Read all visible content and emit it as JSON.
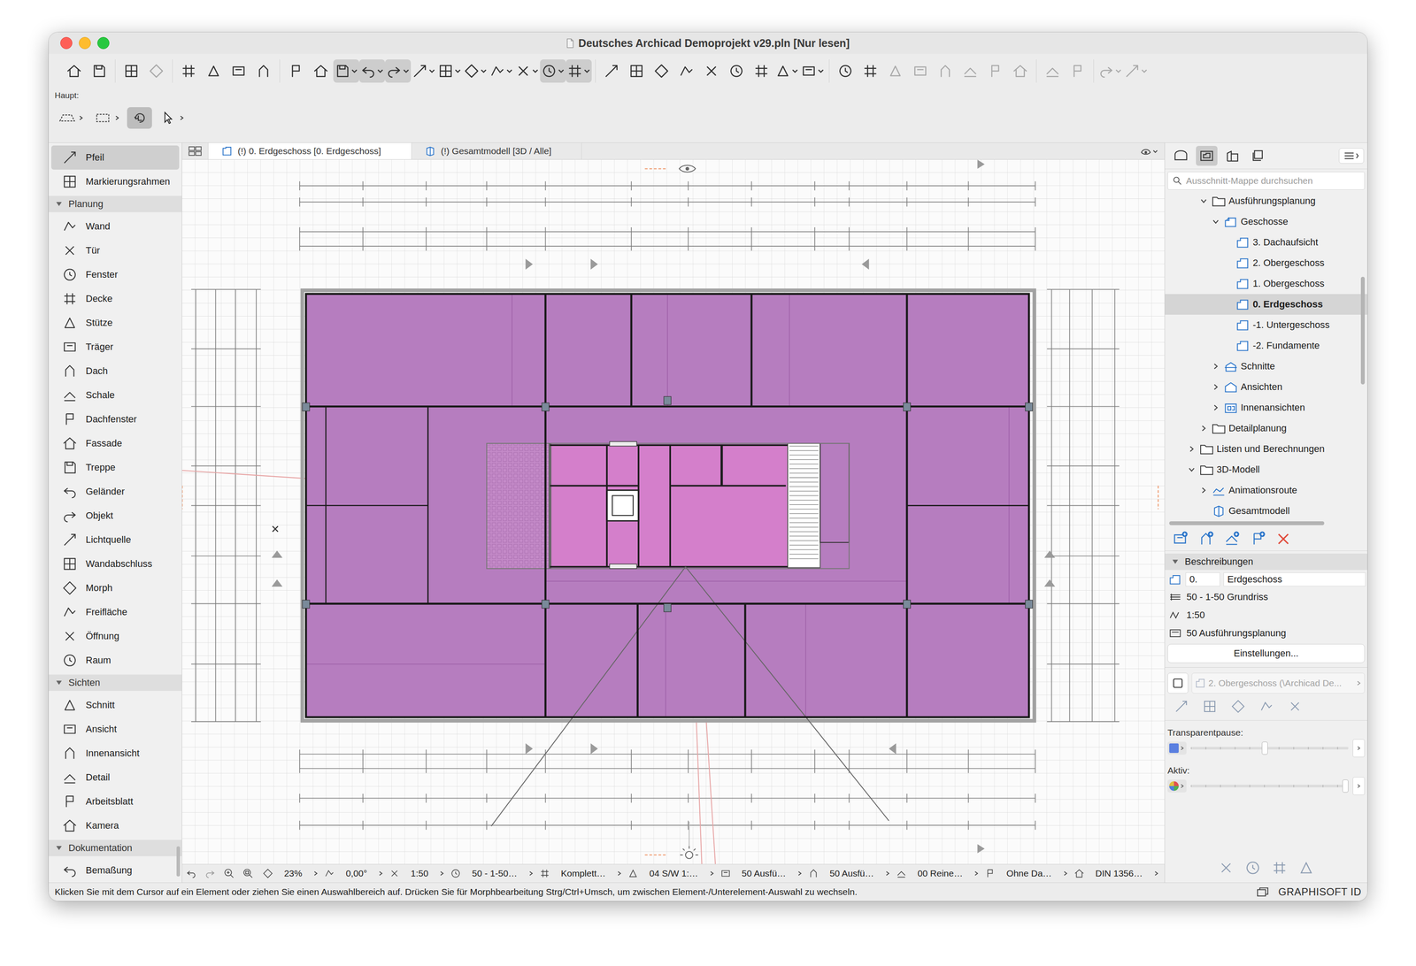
{
  "window": {
    "title": "Deutsches Archicad Demoprojekt v29.pln [Nur lesen]"
  },
  "toolbar": {
    "groups": [
      [
        {
          "pressed": false,
          "dropdown": false,
          "disabled": false
        },
        {
          "pressed": false,
          "dropdown": false,
          "disabled": false
        }
      ],
      [
        {
          "pressed": false,
          "dropdown": false,
          "disabled": false
        },
        {
          "pressed": false,
          "dropdown": false,
          "disabled": true
        }
      ],
      [
        {
          "pressed": false,
          "dropdown": false,
          "disabled": false
        },
        {
          "pressed": false,
          "dropdown": false,
          "disabled": false
        },
        {
          "pressed": false,
          "dropdown": false,
          "disabled": false
        },
        {
          "pressed": false,
          "dropdown": false,
          "disabled": false
        }
      ],
      [
        {
          "pressed": false,
          "dropdown": false,
          "disabled": false
        },
        {
          "pressed": false,
          "dropdown": false,
          "disabled": false
        },
        {
          "pressed": true,
          "dropdown": true,
          "disabled": false
        },
        {
          "pressed": true,
          "dropdown": true,
          "disabled": false
        },
        {
          "pressed": true,
          "dropdown": true,
          "disabled": false
        },
        {
          "pressed": false,
          "dropdown": true,
          "disabled": false
        },
        {
          "pressed": false,
          "dropdown": true,
          "disabled": false
        },
        {
          "pressed": false,
          "dropdown": true,
          "disabled": false
        },
        {
          "pressed": false,
          "dropdown": true,
          "disabled": false
        },
        {
          "pressed": false,
          "dropdown": true,
          "disabled": false
        },
        {
          "pressed": true,
          "dropdown": true,
          "disabled": false
        },
        {
          "pressed": true,
          "dropdown": true,
          "disabled": false
        }
      ],
      [
        {
          "pressed": false,
          "dropdown": false,
          "disabled": false
        },
        {
          "pressed": false,
          "dropdown": false,
          "disabled": false
        },
        {
          "pressed": false,
          "dropdown": false,
          "disabled": false
        },
        {
          "pressed": false,
          "dropdown": false,
          "disabled": false
        },
        {
          "pressed": false,
          "dropdown": false,
          "disabled": false
        },
        {
          "pressed": false,
          "dropdown": false,
          "disabled": false
        },
        {
          "pressed": false,
          "dropdown": false,
          "disabled": false
        },
        {
          "pressed": false,
          "dropdown": true,
          "disabled": false
        },
        {
          "pressed": false,
          "dropdown": true,
          "disabled": false
        }
      ],
      [
        {
          "pressed": false,
          "dropdown": false,
          "disabled": false
        },
        {
          "pressed": false,
          "dropdown": false,
          "disabled": false
        },
        {
          "pressed": false,
          "dropdown": false,
          "disabled": true
        },
        {
          "pressed": false,
          "dropdown": false,
          "disabled": true
        },
        {
          "pressed": false,
          "dropdown": false,
          "disabled": true
        },
        {
          "pressed": false,
          "dropdown": false,
          "disabled": true
        },
        {
          "pressed": false,
          "dropdown": false,
          "disabled": true
        },
        {
          "pressed": false,
          "dropdown": false,
          "disabled": true
        }
      ],
      [
        {
          "pressed": false,
          "dropdown": false,
          "disabled": true
        },
        {
          "pressed": false,
          "dropdown": false,
          "disabled": true
        }
      ],
      [
        {
          "pressed": false,
          "dropdown": true,
          "disabled": true
        },
        {
          "pressed": false,
          "dropdown": true,
          "disabled": true
        }
      ]
    ]
  },
  "infobox": {
    "label": "Haupt:"
  },
  "toolbox": {
    "items": [
      {
        "kind": "tool",
        "label": "Pfeil",
        "selected": true,
        "expanded": false
      },
      {
        "kind": "tool",
        "label": "Markierungsrahmen",
        "selected": false,
        "expanded": false
      },
      {
        "kind": "section",
        "label": "Planung",
        "selected": false,
        "expanded": true
      },
      {
        "kind": "tool",
        "label": "Wand",
        "selected": false,
        "expanded": false
      },
      {
        "kind": "tool",
        "label": "Tür",
        "selected": false,
        "expanded": false
      },
      {
        "kind": "tool",
        "label": "Fenster",
        "selected": false,
        "expanded": false
      },
      {
        "kind": "tool",
        "label": "Decke",
        "selected": false,
        "expanded": false
      },
      {
        "kind": "tool",
        "label": "Stütze",
        "selected": false,
        "expanded": false
      },
      {
        "kind": "tool",
        "label": "Träger",
        "selected": false,
        "expanded": false
      },
      {
        "kind": "tool",
        "label": "Dach",
        "selected": false,
        "expanded": false
      },
      {
        "kind": "tool",
        "label": "Schale",
        "selected": false,
        "expanded": false
      },
      {
        "kind": "tool",
        "label": "Dachfenster",
        "selected": false,
        "expanded": false
      },
      {
        "kind": "tool",
        "label": "Fassade",
        "selected": false,
        "expanded": false
      },
      {
        "kind": "tool",
        "label": "Treppe",
        "selected": false,
        "expanded": false
      },
      {
        "kind": "tool",
        "label": "Geländer",
        "selected": false,
        "expanded": false
      },
      {
        "kind": "tool",
        "label": "Objekt",
        "selected": false,
        "expanded": false
      },
      {
        "kind": "tool",
        "label": "Lichtquelle",
        "selected": false,
        "expanded": false
      },
      {
        "kind": "tool",
        "label": "Wandabschluss",
        "selected": false,
        "expanded": false
      },
      {
        "kind": "tool",
        "label": "Morph",
        "selected": false,
        "expanded": false
      },
      {
        "kind": "tool",
        "label": "Freifläche",
        "selected": false,
        "expanded": false
      },
      {
        "kind": "tool",
        "label": "Öffnung",
        "selected": false,
        "expanded": false
      },
      {
        "kind": "tool",
        "label": "Raum",
        "selected": false,
        "expanded": false
      },
      {
        "kind": "section",
        "label": "Sichten",
        "selected": false,
        "expanded": true
      },
      {
        "kind": "tool",
        "label": "Schnitt",
        "selected": false,
        "expanded": false
      },
      {
        "kind": "tool",
        "label": "Ansicht",
        "selected": false,
        "expanded": false
      },
      {
        "kind": "tool",
        "label": "Innenansicht",
        "selected": false,
        "expanded": false
      },
      {
        "kind": "tool",
        "label": "Detail",
        "selected": false,
        "expanded": false
      },
      {
        "kind": "tool",
        "label": "Arbeitsblatt",
        "selected": false,
        "expanded": false
      },
      {
        "kind": "tool",
        "label": "Kamera",
        "selected": false,
        "expanded": false
      },
      {
        "kind": "section",
        "label": "Dokumentation",
        "selected": false,
        "expanded": true
      },
      {
        "kind": "tool",
        "label": "Bemaßung",
        "selected": false,
        "expanded": false
      }
    ]
  },
  "tabs": [
    {
      "label": "(!) 0. Erdgeschoss [0. Erdgeschoss]",
      "selected": true,
      "kind": "plan"
    },
    {
      "label": "(!) Gesamtmodell [3D / Alle]",
      "selected": false,
      "kind": "model"
    }
  ],
  "quick_options": [
    {
      "label": "23%"
    },
    {
      "label": "0,00°"
    },
    {
      "label": "1:50"
    },
    {
      "label": "50 - 1-50…"
    },
    {
      "label": "Komplett…"
    },
    {
      "label": "04 S/W 1:…"
    },
    {
      "label": "50 Ausfü…"
    },
    {
      "label": "50 Ausfü…"
    },
    {
      "label": "00 Reine…"
    },
    {
      "label": "Ohne Da…"
    },
    {
      "label": "DIN 1356…"
    }
  ],
  "navigator": {
    "tabs": [
      {
        "selected": false
      },
      {
        "selected": true
      },
      {
        "selected": false
      },
      {
        "selected": false
      }
    ],
    "search_placeholder": "Ausschnitt-Mappe durchsuchen",
    "tree": [
      {
        "label": "Ausführungsplanung",
        "level": 1,
        "kind": "folder",
        "expandable": true,
        "expanded": true,
        "selected": false
      },
      {
        "label": "Geschosse",
        "level": 2,
        "kind": "stories",
        "expandable": true,
        "expanded": true,
        "selected": false
      },
      {
        "label": "3. Dachaufsicht",
        "level": 3,
        "kind": "story",
        "expandable": false,
        "expanded": false,
        "selected": false
      },
      {
        "label": "2. Obergeschoss",
        "level": 3,
        "kind": "story",
        "expandable": false,
        "expanded": false,
        "selected": false
      },
      {
        "label": "1. Obergeschoss",
        "level": 3,
        "kind": "story",
        "expandable": false,
        "expanded": false,
        "selected": false
      },
      {
        "label": "0. Erdgeschoss",
        "level": 3,
        "kind": "story",
        "expandable": false,
        "expanded": false,
        "selected": true
      },
      {
        "label": "-1. Untergeschoss",
        "level": 3,
        "kind": "story",
        "expandable": false,
        "expanded": false,
        "selected": false
      },
      {
        "label": "-2. Fundamente",
        "level": 3,
        "kind": "story",
        "expandable": false,
        "expanded": false,
        "selected": false
      },
      {
        "label": "Schnitte",
        "level": 2,
        "kind": "section",
        "expandable": true,
        "expanded": false,
        "selected": false
      },
      {
        "label": "Ansichten",
        "level": 2,
        "kind": "elevation",
        "expandable": true,
        "expanded": false,
        "selected": false
      },
      {
        "label": "Innenansichten",
        "level": 2,
        "kind": "interior",
        "expandable": true,
        "expanded": false,
        "selected": false
      },
      {
        "label": "Detailplanung",
        "level": 1,
        "kind": "folder",
        "expandable": true,
        "expanded": false,
        "selected": false
      },
      {
        "label": "Listen und Berechnungen",
        "level": 0,
        "kind": "folder",
        "expandable": true,
        "expanded": false,
        "selected": false
      },
      {
        "label": "3D-Modell",
        "level": 0,
        "kind": "folder",
        "expandable": true,
        "expanded": true,
        "selected": false
      },
      {
        "label": "Animationsroute",
        "level": 1,
        "kind": "path",
        "expandable": true,
        "expanded": false,
        "selected": false
      },
      {
        "label": "Gesamtmodell",
        "level": 1,
        "kind": "model",
        "expandable": false,
        "expanded": false,
        "selected": false
      }
    ]
  },
  "properties": {
    "header": "Beschreibungen",
    "expanded": true,
    "id": "0.",
    "name": "Erdgeschoss",
    "rows": [
      "50 - 1-50 Grundriss",
      "1:50",
      "50 Ausführungsplanung"
    ],
    "button": "Einstellungen...",
    "trace_reference": {
      "label": "2. Obergeschoss (\\Archicad De...",
      "disabled": true
    },
    "sliders": [
      {
        "label": "Transparentpause:",
        "level": 0.47
      },
      {
        "label": "Aktiv:",
        "level": 0.98
      }
    ]
  },
  "status_bar": {
    "message": "Klicken Sie mit dem Cursor auf ein Element oder ziehen Sie einen Auswahlbereich auf. Drücken Sie für Morphbearbeitung Strg/Ctrl+Umsch, um zwischen Element-/Unterelement-Auswahl zu wechseln.",
    "brand": "GRAPHISOFT ID"
  }
}
